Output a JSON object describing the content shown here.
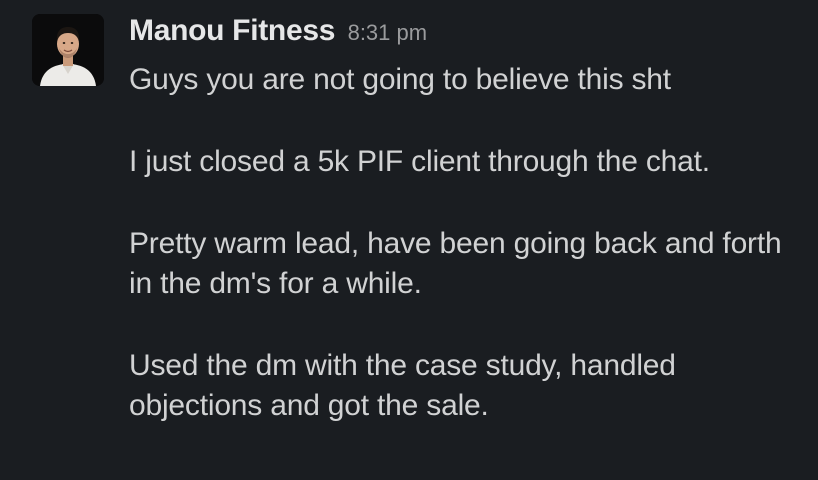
{
  "message": {
    "author": "Manou Fitness",
    "timestamp": "8:31 pm",
    "avatar_icon": "user-avatar-photo",
    "paragraphs": [
      "Guys you are not going to believe this sht",
      "I just closed a 5k PIF client through the chat.",
      "Pretty warm lead, have been going back and forth in the dm's for a while.",
      "Used the dm with the case study, handled objections and got the sale."
    ]
  },
  "colors": {
    "background": "#1a1d21",
    "author_text": "#e6e7e8",
    "body_text": "#d1d2d3",
    "timestamp_text": "#9a9b9d"
  }
}
